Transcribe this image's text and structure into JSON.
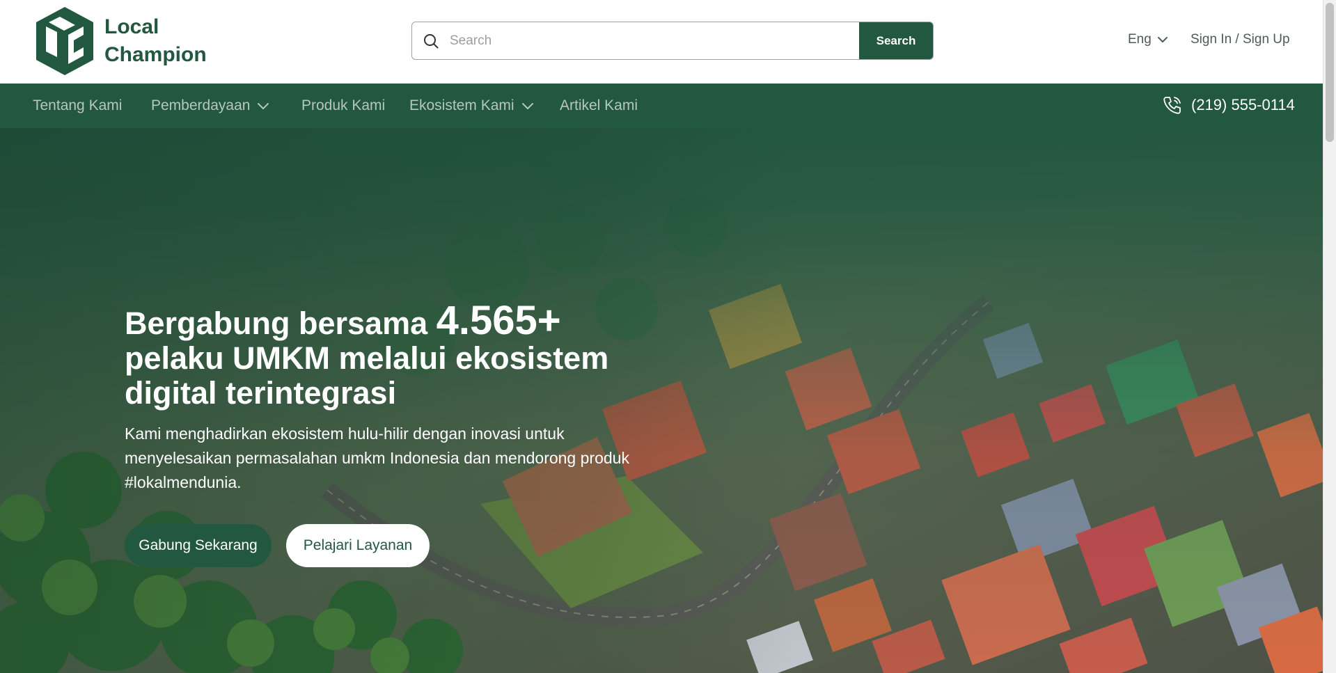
{
  "brand": {
    "name_line1": "Local",
    "name_line2": "Champion",
    "color": "#225740"
  },
  "search": {
    "placeholder": "Search",
    "value": "",
    "button_label": "Search",
    "icon": "search-icon"
  },
  "header": {
    "language": "Eng",
    "auth_label": "Sign In / Sign Up"
  },
  "nav": {
    "items": [
      {
        "label": "Tentang Kami",
        "has_dropdown": false
      },
      {
        "label": "Pemberdayaan",
        "has_dropdown": true
      },
      {
        "label": "Produk Kami",
        "has_dropdown": false
      },
      {
        "label": "Ekosistem Kami",
        "has_dropdown": true
      },
      {
        "label": "Artikel Kami",
        "has_dropdown": false
      }
    ],
    "phone": "(219) 555-0114",
    "phone_icon": "phone-icon"
  },
  "hero": {
    "title_prefix": "Bergabung bersama ",
    "title_number": "4.565+",
    "title_suffix": "pelaku UMKM melalui ekosistem digital terintegrasi",
    "description": "Kami menghadirkan ekosistem hulu-hilir dengan inovasi untuk menyelesaikan permasalahan umkm Indonesia dan mendorong produk #lokalmendunia.",
    "primary_cta": "Gabung Sekarang",
    "secondary_cta": "Pelajari Layanan"
  },
  "colors": {
    "primary": "#225740",
    "nav_text": "#b7c6be",
    "white": "#ffffff"
  }
}
